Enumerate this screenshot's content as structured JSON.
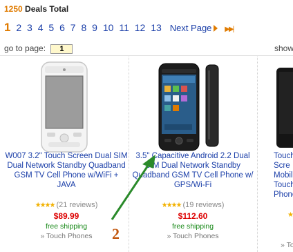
{
  "header": {
    "deals_count": "1250",
    "deals_label": "Deals Total"
  },
  "pager": {
    "current": "1",
    "pages": [
      "2",
      "3",
      "4",
      "5",
      "6",
      "7",
      "8",
      "9",
      "10",
      "11",
      "12",
      "13"
    ],
    "next_label": "Next Page"
  },
  "goto": {
    "label": "go to page:",
    "value": "1"
  },
  "show_label": "show",
  "products": [
    {
      "title": "W007 3.2\" Touch Screen Dual SIM Dual Network Standby Quadband GSM TV Cell Phone w/WiFi + JAVA",
      "reviews": "(21 reviews)",
      "price": "$89.99",
      "shipping": "free shipping",
      "category": "» Touch Phones"
    },
    {
      "title": "3.5\" Capacitive Android 2.2 Dual SIM Dual Network Standby Quadband GSM TV Cell Phone w/ GPS/Wi-Fi",
      "reviews": "(19 reviews)",
      "price": "$112.60",
      "shipping": "free shipping",
      "category": "» Touch Phones"
    },
    {
      "title": "Touch Scre Mobile Touch Phone",
      "reviews": "",
      "price": "",
      "shipping": "",
      "category": "» To"
    }
  ],
  "annotation": {
    "number": "2",
    "color": "#2a8a2a"
  },
  "colors": {
    "link": "#1a3ea8",
    "accent": "#e07b00",
    "price": "#dd0000",
    "shipping": "#1a8a1a"
  }
}
